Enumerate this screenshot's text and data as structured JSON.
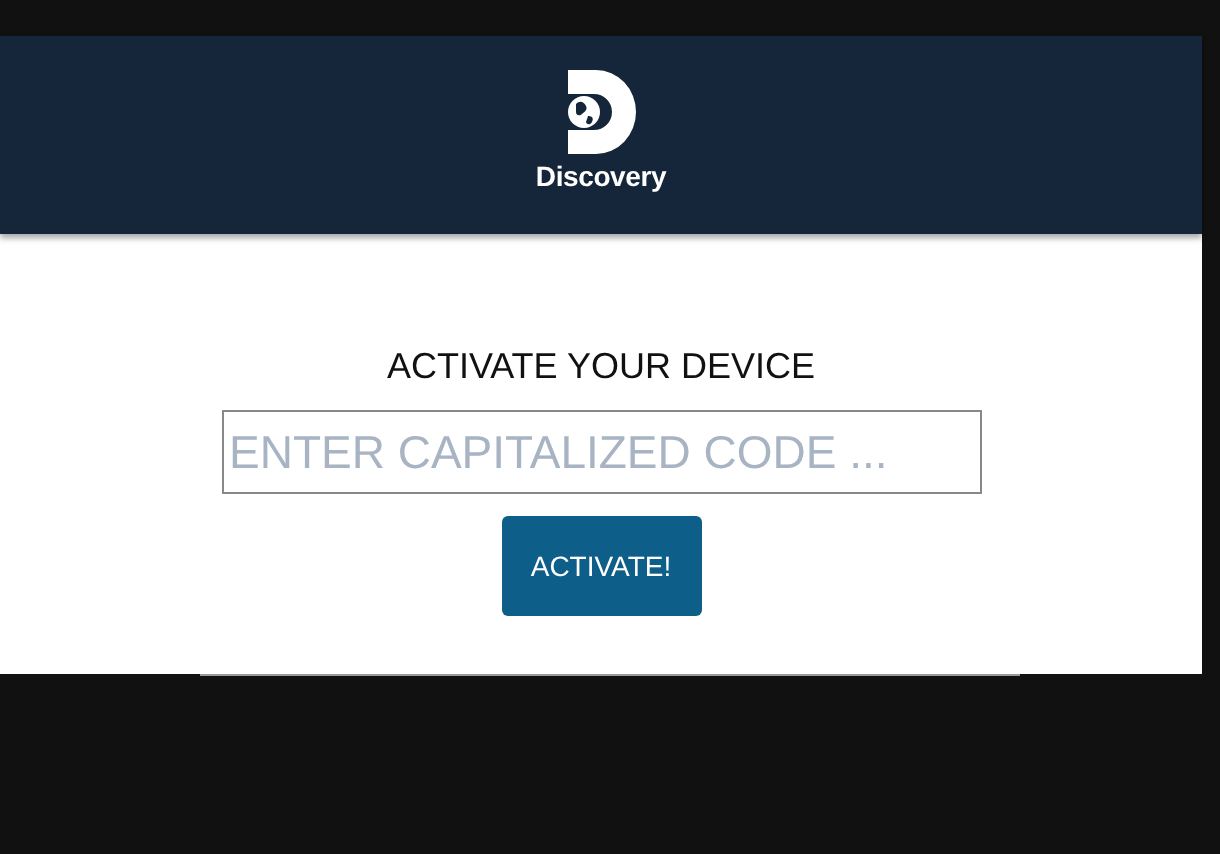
{
  "header": {
    "logo_text": "Discovery"
  },
  "form": {
    "title": "ACTIVATE YOUR DEVICE",
    "code_field": {
      "placeholder": "ENTER CAPITALIZED CODE ..."
    },
    "button": "ACTIVATE!"
  }
}
